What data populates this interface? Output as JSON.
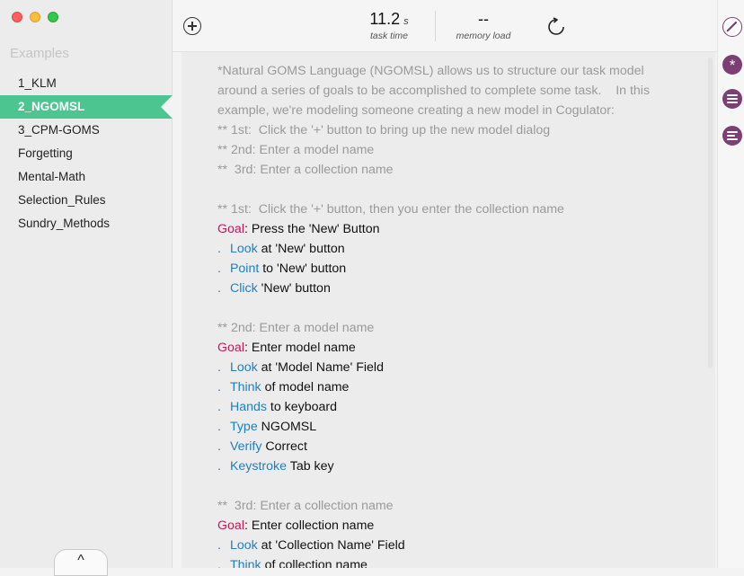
{
  "window_controls": [
    "close",
    "minimize",
    "maximize"
  ],
  "sidebar": {
    "header": "Examples",
    "items": [
      {
        "label": "1_KLM"
      },
      {
        "label": "2_NGOMSL",
        "selected": true
      },
      {
        "label": "3_CPM-GOMS"
      },
      {
        "label": "Forgetting"
      },
      {
        "label": "Mental-Math"
      },
      {
        "label": "Selection_Rules"
      },
      {
        "label": "Sundry_Methods"
      }
    ],
    "collapse_label": "^"
  },
  "toolbar": {
    "task_time": {
      "value": "11.2",
      "unit": "s",
      "label": "task time"
    },
    "memory_load": {
      "value": "--",
      "label": "memory load"
    },
    "icons": [
      "plus-circle-icon",
      "refresh-icon"
    ]
  },
  "editor": {
    "lines": [
      [
        {
          "t": "*Natural GOMS Language (NGOMSL) allows us to structure our task model",
          "k": "comment"
        }
      ],
      [
        {
          "t": "around a series of goals to be accomplished to complete some task.    In this",
          "k": "comment"
        }
      ],
      [
        {
          "t": "example, we're modeling someone creating a new model in Cogulator:",
          "k": "comment"
        }
      ],
      [
        {
          "t": "** 1st:  Click the '+' button to bring up the new model dialog",
          "k": "comment"
        }
      ],
      [
        {
          "t": "** 2nd: Enter a model name",
          "k": "comment"
        }
      ],
      [
        {
          "t": "**  3rd: Enter a collection name",
          "k": "comment"
        }
      ],
      [],
      [
        {
          "t": "** 1st:  Click the '+' button, then you enter the collection name",
          "k": "comment"
        }
      ],
      [
        {
          "t": "Goal",
          "k": "goal"
        },
        {
          "t": ": Press the 'New' Button",
          "k": "text"
        }
      ],
      [
        {
          "t": ".",
          "k": "dot"
        },
        {
          "t": "Look",
          "k": "op"
        },
        {
          "t": " at 'New' button",
          "k": "text"
        }
      ],
      [
        {
          "t": ".",
          "k": "dot"
        },
        {
          "t": "Point",
          "k": "op"
        },
        {
          "t": " to 'New' button",
          "k": "text"
        }
      ],
      [
        {
          "t": ".",
          "k": "dot"
        },
        {
          "t": "Click",
          "k": "op"
        },
        {
          "t": " 'New' button",
          "k": "text"
        }
      ],
      [],
      [
        {
          "t": "** 2nd: Enter a model name",
          "k": "comment"
        }
      ],
      [
        {
          "t": "Goal",
          "k": "goal"
        },
        {
          "t": ": Enter model name",
          "k": "text"
        }
      ],
      [
        {
          "t": ".",
          "k": "dot"
        },
        {
          "t": "Look",
          "k": "op"
        },
        {
          "t": " at 'Model Name' Field",
          "k": "text"
        }
      ],
      [
        {
          "t": ".",
          "k": "dot"
        },
        {
          "t": "Think",
          "k": "op"
        },
        {
          "t": " of model name",
          "k": "text"
        }
      ],
      [
        {
          "t": ".",
          "k": "dot"
        },
        {
          "t": "Hands",
          "k": "op"
        },
        {
          "t": " to keyboard",
          "k": "text"
        }
      ],
      [
        {
          "t": ".",
          "k": "dot"
        },
        {
          "t": "Type",
          "k": "op"
        },
        {
          "t": " NGOMSL",
          "k": "text"
        }
      ],
      [
        {
          "t": ".",
          "k": "dot"
        },
        {
          "t": "Verify",
          "k": "op"
        },
        {
          "t": " Correct",
          "k": "text"
        }
      ],
      [
        {
          "t": ".",
          "k": "dot"
        },
        {
          "t": "Keystroke",
          "k": "op"
        },
        {
          "t": " Tab key",
          "k": "text"
        }
      ],
      [],
      [
        {
          "t": "**  3rd: Enter a collection name",
          "k": "comment"
        }
      ],
      [
        {
          "t": "Goal",
          "k": "goal"
        },
        {
          "t": ": Enter collection name",
          "k": "text"
        }
      ],
      [
        {
          "t": ".",
          "k": "dot"
        },
        {
          "t": "Look",
          "k": "op"
        },
        {
          "t": " at 'Collection Name' Field",
          "k": "text"
        }
      ],
      [
        {
          "t": ".",
          "k": "dot"
        },
        {
          "t": "Think",
          "k": "op"
        },
        {
          "t": " of collection name",
          "k": "text"
        }
      ]
    ]
  },
  "tool_rail": {
    "icons": [
      "pencil-icon",
      "asterisk-icon",
      "list-icon",
      "list-icon"
    ],
    "asterisk_glyph": "*"
  },
  "colors": {
    "accent": "#4cc591",
    "goal": "#c2185b",
    "operator": "#1f7fc1",
    "comment": "#9a9a9a",
    "rail_icon": "#7b3f73"
  }
}
